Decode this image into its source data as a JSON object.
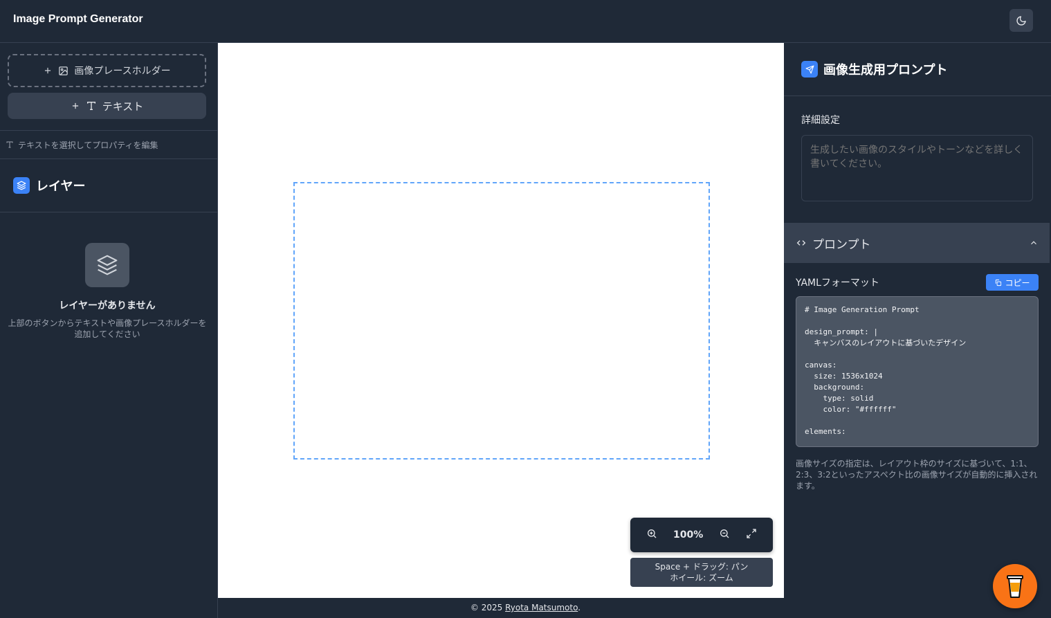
{
  "header": {
    "title": "Image Prompt Generator",
    "theme_icon": "moon-icon"
  },
  "left_panel": {
    "add_image_label": "画像プレースホルダー",
    "add_text_label": "テキスト",
    "hint": "テキストを選択してプロパティを編集",
    "layers_title": "レイヤー",
    "empty_title": "レイヤーがありません",
    "empty_desc": "上部のボタンからテキストや画像プレースホルダーを追加してください"
  },
  "canvas": {
    "background": "#ffffff",
    "frame_color": "#60a5fa",
    "zoom": "100%",
    "hint_line1": "Space + ドラッグ: パン",
    "hint_line2": "ホイール: ズーム"
  },
  "right_panel": {
    "title": "画像生成用プロンプト",
    "details_label": "詳細設定",
    "details_placeholder": "生成したい画像のスタイルやトーンなどを詳しく書いてください。",
    "prompt_section": "プロンプト",
    "yaml_label": "YAMLフォーマット",
    "copy_label": "コピー",
    "yaml_text": "# Image Generation Prompt\n\ndesign_prompt: |\n  キャンバスのレイアウトに基づいたデザイン\n\ncanvas:\n  size: 1536x1024\n  background:\n    type: solid\n    color: \"#ffffff\"\n\nelements:",
    "note": "画像サイズの指定は、レイアウト枠のサイズに基づいて、1:1、2:3、3:2といったアスペクト比の画像サイズが自動的に挿入されます。"
  },
  "footer": {
    "prefix": "© 2025 ",
    "author": "Ryota Matsumoto",
    "suffix": "."
  },
  "colors": {
    "accent": "#3b82f6",
    "coffee": "#f97316",
    "bg": "#1f2937"
  }
}
